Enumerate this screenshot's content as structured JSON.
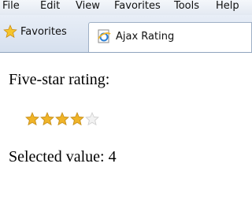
{
  "menu": [
    "File",
    "Edit",
    "View",
    "Favorites",
    "Tools",
    "Help"
  ],
  "toolbar": {
    "favorites_label": "Favorites",
    "favorites_icon": "star-icon"
  },
  "tab": {
    "title": "Ajax Rating",
    "icon": "ie-page-icon"
  },
  "content": {
    "heading": "Five-star rating:",
    "rating": {
      "max": 5,
      "value": 4,
      "filled_color": "#f0b428",
      "empty_color": "#d0d0d0"
    },
    "selected_text": "Selected value: 4"
  }
}
